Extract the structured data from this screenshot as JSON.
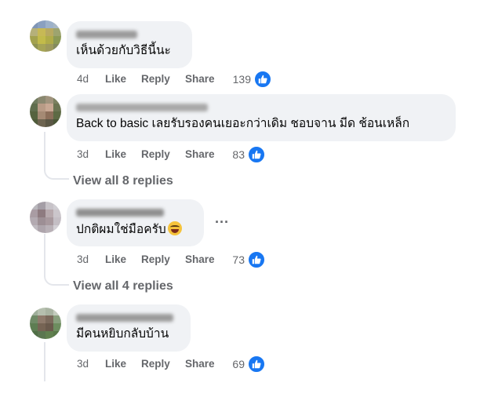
{
  "comments": [
    {
      "text": "เห็นด้วยกับวิธีนี้นะ",
      "time": "4d",
      "like_label": "Like",
      "reply_label": "Reply",
      "share_label": "Share",
      "likes": "139"
    },
    {
      "text": "Back to basic เลยรับรองคนเยอะกว่าเดิม ชอบจาน มีด ช้อนเหล็ก",
      "time": "3d",
      "like_label": "Like",
      "reply_label": "Reply",
      "share_label": "Share",
      "likes": "83",
      "view_replies": "View all 8 replies"
    },
    {
      "text": "ปกติผมใช่มือครับ",
      "time": "3d",
      "like_label": "Like",
      "reply_label": "Reply",
      "share_label": "Share",
      "likes": "73",
      "more_label": "···",
      "view_replies": "View all 4 replies"
    },
    {
      "text": "มีคนหยิบกลับบ้าน",
      "time": "3d",
      "like_label": "Like",
      "reply_label": "Reply",
      "share_label": "Share",
      "likes": "69"
    }
  ],
  "icons": {
    "like": "thumbs-up-icon",
    "reaction_emoji": "laughing-emoji-icon",
    "more": "more-options-icon"
  },
  "colors": {
    "bubble": "#f0f2f5",
    "meta_text": "#65676b",
    "like_blue": "#1877f2",
    "thread_line": "#e4e6eb"
  }
}
